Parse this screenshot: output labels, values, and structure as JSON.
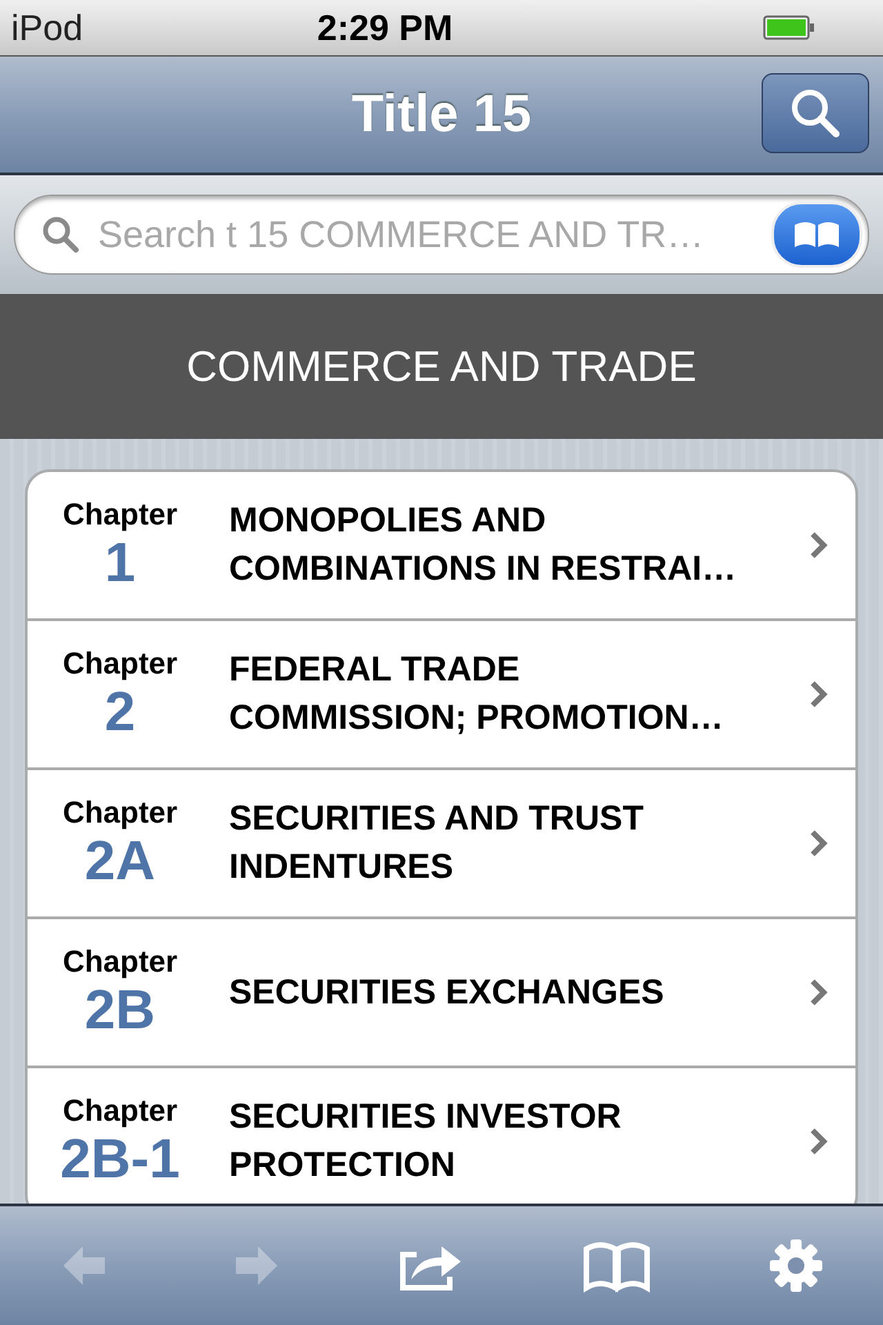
{
  "status_bar": {
    "carrier": "iPod",
    "time": "2:29 PM",
    "battery": {
      "level": 1
    }
  },
  "nav_bar": {
    "title": "Title 15"
  },
  "search": {
    "placeholder": "Search t 15 COMMERCE AND TR…"
  },
  "section_header": "COMMERCE AND TRADE",
  "chapters": [
    {
      "label": "Chapter",
      "number": "1",
      "title": "MONOPOLIES AND COMBINATIONS IN RESTRAI…"
    },
    {
      "label": "Chapter",
      "number": "2",
      "title": "FEDERAL TRADE COMMISSION; PROMOTION…"
    },
    {
      "label": "Chapter",
      "number": "2A",
      "title": "SECURITIES AND TRUST INDENTURES"
    },
    {
      "label": "Chapter",
      "number": "2B",
      "title": "SECURITIES EXCHANGES"
    },
    {
      "label": "Chapter",
      "number": "2B-1",
      "title": "SECURITIES INVESTOR PROTECTION"
    }
  ],
  "toolbar": [
    {
      "kind": "back",
      "disabled": true
    },
    {
      "kind": "forward",
      "disabled": true
    },
    {
      "kind": "share",
      "disabled": false
    },
    {
      "kind": "bookmarks",
      "disabled": false
    },
    {
      "kind": "settings",
      "disabled": false
    }
  ]
}
